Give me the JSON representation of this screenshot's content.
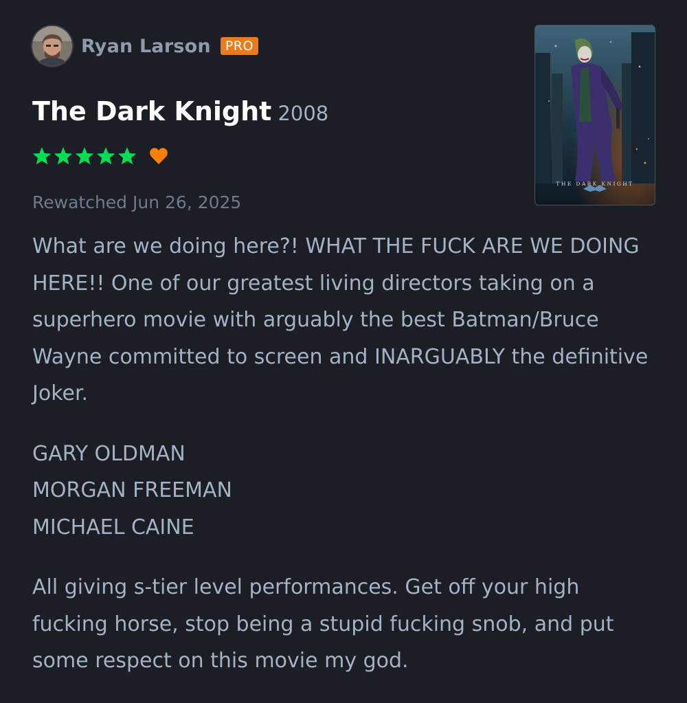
{
  "review": {
    "author": {
      "name": "Ryan Larson",
      "badge": "PRO",
      "avatar_icon": "avatar-photo"
    },
    "film": {
      "title": "The Dark Knight",
      "year": "2008",
      "poster_caption": "THE DARK KNIGHT"
    },
    "rating": {
      "stars": 5,
      "max_stars": 5,
      "liked": true,
      "star_color": "#00e054",
      "heart_color": "#ff8000"
    },
    "watched_label": "Rewatched Jun 26, 2025",
    "paragraphs": [
      "What are we doing here?! WHAT THE FUCK ARE WE DOING HERE!! One of our greatest living directors taking on a superhero movie with arguably the best Batman/Bruce Wayne committed to screen and INARGUABLY the definitive Joker.",
      "GARY OLDMAN\nMORGAN FREEMAN\nMICHAEL CAINE",
      "All giving s-tier level performances. Get off your high fucking horse, stop being a stupid fucking snob, and put some respect on this movie my god."
    ]
  },
  "colors": {
    "background": "#1b1e24",
    "badge": "#ef7a1a",
    "body_text": "#a5b2c3",
    "meta_text": "#6f7b8c"
  }
}
